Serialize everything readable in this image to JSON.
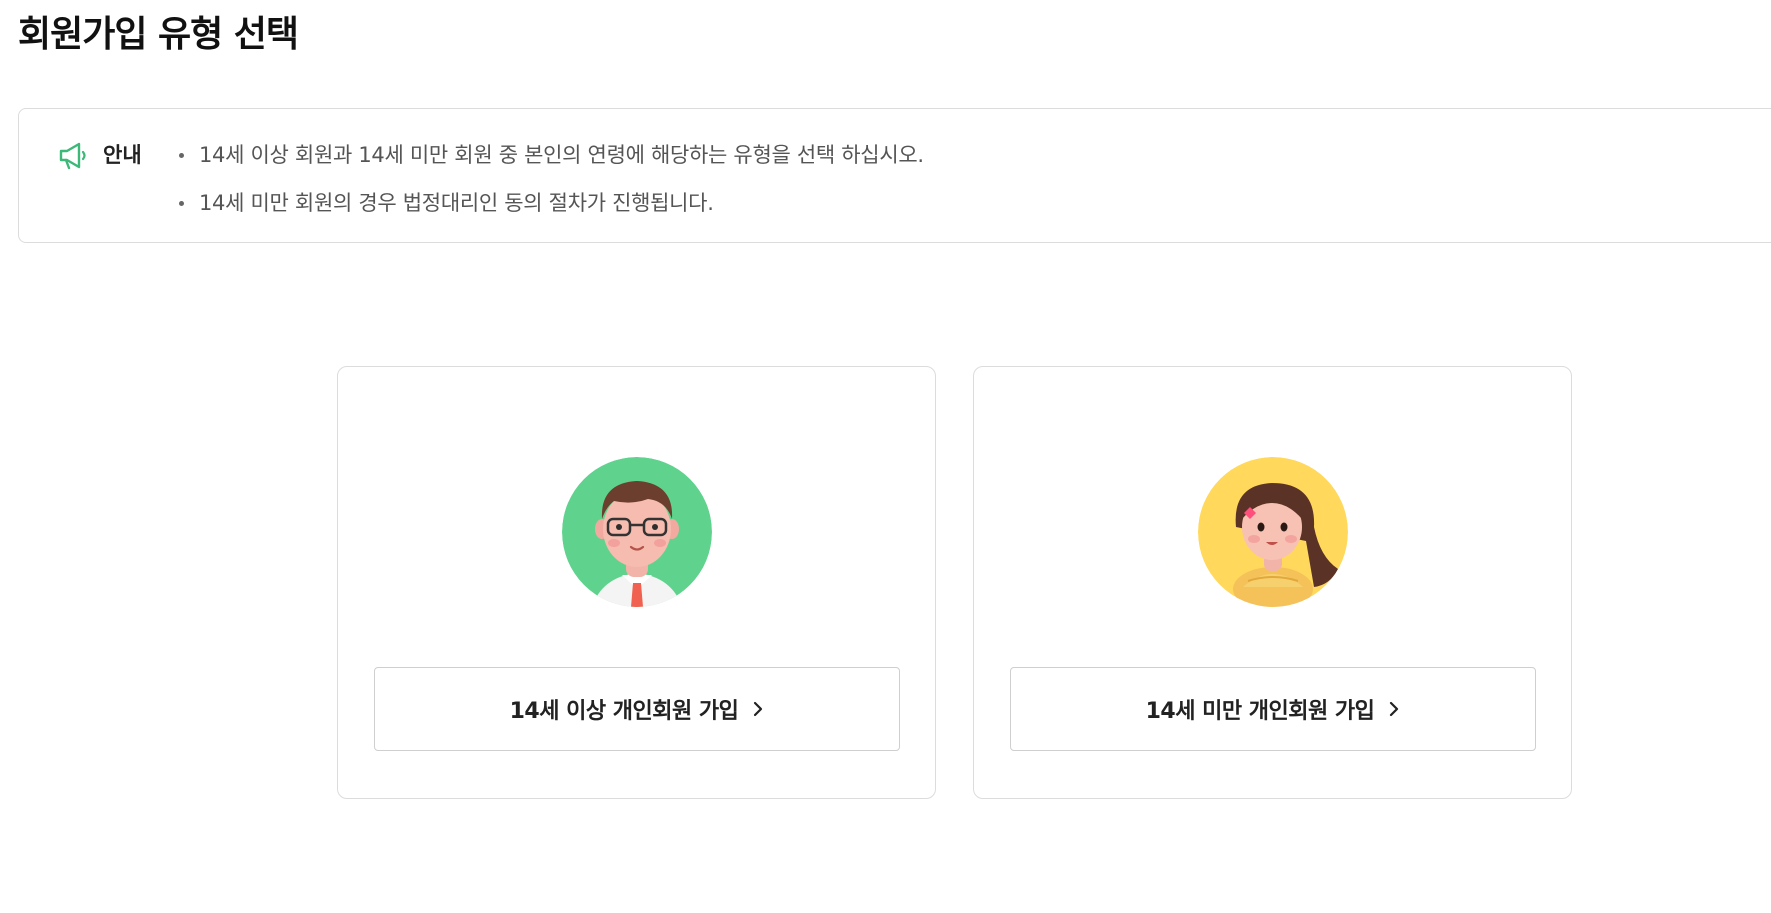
{
  "page": {
    "title": "회원가입 유형 선택"
  },
  "notice": {
    "label": "안내",
    "icon": "megaphone-icon",
    "items": [
      "14세 이상 회원과 14세 미만 회원 중 본인의 연령에 해당하는 유형을 선택 하십시오.",
      "14세 미만 회원의 경우 법정대리인 동의 절차가 진행됩니다."
    ]
  },
  "cards": [
    {
      "avatar": "adult-avatar",
      "avatar_color": "#5fd38d",
      "button_label": "14세 이상 개인회원 가입",
      "icon": "chevron-right-icon"
    },
    {
      "avatar": "child-avatar",
      "avatar_color": "#ffd85c",
      "button_label": "14세 미만 개인회원 가입",
      "icon": "chevron-right-icon"
    }
  ],
  "colors": {
    "accent": "#3cb878",
    "border": "#dcdcdc",
    "text": "#222222",
    "muted_text": "#555555"
  }
}
